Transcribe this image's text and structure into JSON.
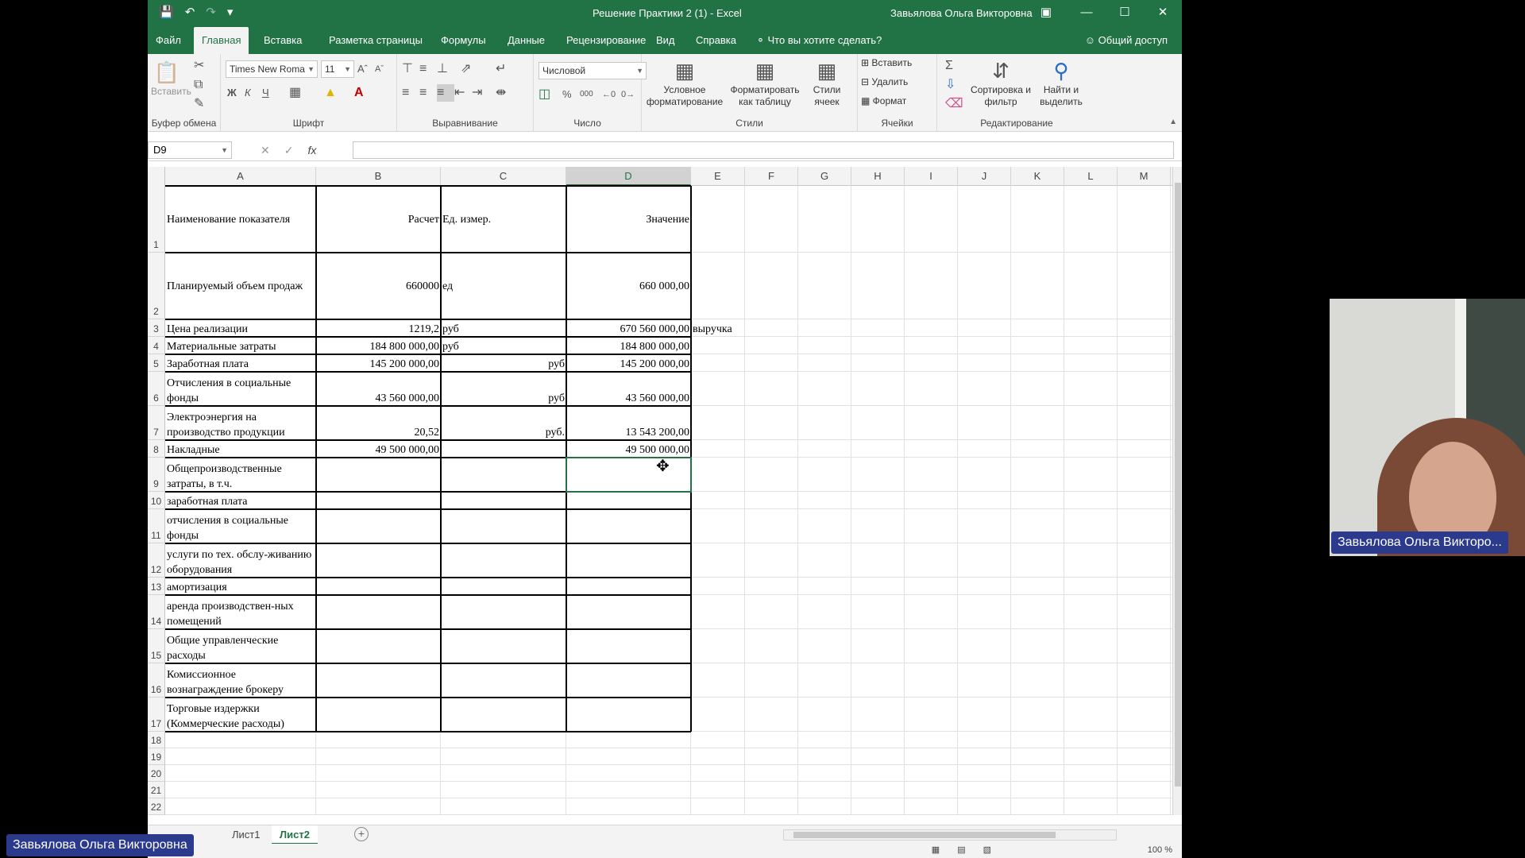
{
  "window": {
    "doc_title": "Решение Практики 2 (1)  -  Excel",
    "user_name": "Завьялова Ольга Викторовна"
  },
  "tabs": [
    {
      "label": "Файл"
    },
    {
      "label": "Главная"
    },
    {
      "label": "Вставка"
    },
    {
      "label": "Разметка страницы"
    },
    {
      "label": "Формулы"
    },
    {
      "label": "Данные"
    },
    {
      "label": "Рецензирование"
    },
    {
      "label": "Вид"
    },
    {
      "label": "Справка"
    }
  ],
  "tell_me": "Что вы хотите сделать?",
  "share": "Общий доступ",
  "ribbon": {
    "paste": "Вставить",
    "font_name": "Times New Roma",
    "font_size": "11",
    "bold": "Ж",
    "italic": "К",
    "underline": "Ч",
    "number_format": "Числовой",
    "percent": "%",
    "thousands": "000",
    "conditional": "Условное форматирование",
    "format_table": "Форматировать как таблицу",
    "cell_styles": "Стили ячеек",
    "insert": "Вставить",
    "delete": "Удалить",
    "format": "Формат",
    "sort_filter": "Сортировка и фильтр",
    "find_select": "Найти и выделить",
    "groups": {
      "clipboard": "Буфер обмена",
      "font": "Шрифт",
      "alignment": "Выравнивание",
      "number": "Число",
      "styles": "Стили",
      "cells": "Ячейки",
      "editing": "Редактирование"
    }
  },
  "formula_bar": {
    "name_box": "D9",
    "fx": "fx",
    "content": ""
  },
  "columns": [
    "A",
    "B",
    "C",
    "D",
    "E",
    "F",
    "G",
    "H",
    "I",
    "J",
    "K",
    "L",
    "M"
  ],
  "selected_column": "D",
  "rows": [
    {
      "num": "1",
      "a": "Наименование показателя",
      "b": "Расчет",
      "c": "Ед. измер.",
      "d": "Значение",
      "e": ""
    },
    {
      "num": "2",
      "a": "Планируемый объем продаж",
      "b": "660000",
      "c": "ед",
      "d": "660 000,00",
      "e": ""
    },
    {
      "num": "3",
      "a": "Цена реализации",
      "b": "1219,2",
      "c": "руб",
      "d": "670 560 000,00",
      "e": "выручка"
    },
    {
      "num": "4",
      "a": "Материальные затраты",
      "b": "184 800 000,00",
      "c": "руб",
      "d": "184 800 000,00",
      "e": ""
    },
    {
      "num": "5",
      "a": "Заработная плата",
      "b": "145 200 000,00",
      "c": "руб",
      "d": "145 200 000,00",
      "e": ""
    },
    {
      "num": "6",
      "a": "Отчисления в социальные фонды",
      "b": "43 560 000,00",
      "c": "руб",
      "d": "43 560 000,00",
      "e": ""
    },
    {
      "num": "7",
      "a": "Электроэнергия на производство продукции",
      "b": "20,52",
      "c": "руб.",
      "d": "13 543 200,00",
      "e": ""
    },
    {
      "num": "8",
      "a": "Накладные",
      "b": "49 500 000,00",
      "c": "",
      "d": "49 500 000,00",
      "e": ""
    },
    {
      "num": "9",
      "a": "Общепроизводственные затраты, в т.ч.",
      "b": "",
      "c": "",
      "d": "",
      "e": ""
    },
    {
      "num": "10",
      "a": "заработная плата",
      "b": "",
      "c": "",
      "d": "",
      "e": ""
    },
    {
      "num": "11",
      "a": "отчисления в социальные фонды",
      "b": "",
      "c": "",
      "d": "",
      "e": ""
    },
    {
      "num": "12",
      "a": "услуги по тех. обслу-живанию оборудования",
      "b": "",
      "c": "",
      "d": "",
      "e": ""
    },
    {
      "num": "13",
      "a": "амортизация",
      "b": "",
      "c": "",
      "d": "",
      "e": ""
    },
    {
      "num": "14",
      "a": "аренда производствен-ных помещений",
      "b": "",
      "c": "",
      "d": "",
      "e": ""
    },
    {
      "num": "15",
      "a": "Общие управленческие расходы",
      "b": "",
      "c": "",
      "d": "",
      "e": ""
    },
    {
      "num": "16",
      "a": "Комиссионное вознаграждение брокеру",
      "b": "",
      "c": "",
      "d": "",
      "e": ""
    },
    {
      "num": "17",
      "a": "Торговые издержки (Коммерческие расходы)",
      "b": "",
      "c": "",
      "d": "",
      "e": ""
    },
    {
      "num": "18",
      "a": "",
      "b": "",
      "c": "",
      "d": "",
      "e": ""
    },
    {
      "num": "19",
      "a": "",
      "b": "",
      "c": "",
      "d": "",
      "e": ""
    },
    {
      "num": "20",
      "a": "",
      "b": "",
      "c": "",
      "d": "",
      "e": ""
    },
    {
      "num": "21",
      "a": "",
      "b": "",
      "c": "",
      "d": "",
      "e": ""
    },
    {
      "num": "22",
      "a": "",
      "b": "",
      "c": "",
      "d": "",
      "e": ""
    }
  ],
  "sheets": [
    {
      "label": "Лист1",
      "active": false
    },
    {
      "label": "Лист2",
      "active": true
    }
  ],
  "status": {
    "zoom": "100 %"
  },
  "video": {
    "participant_label": "Завьялова Ольга Викторо...",
    "host_label": "Завьялова Ольга Викторовна"
  },
  "colors": {
    "accent": "#217346",
    "label_bg": "#2b3a8c"
  }
}
